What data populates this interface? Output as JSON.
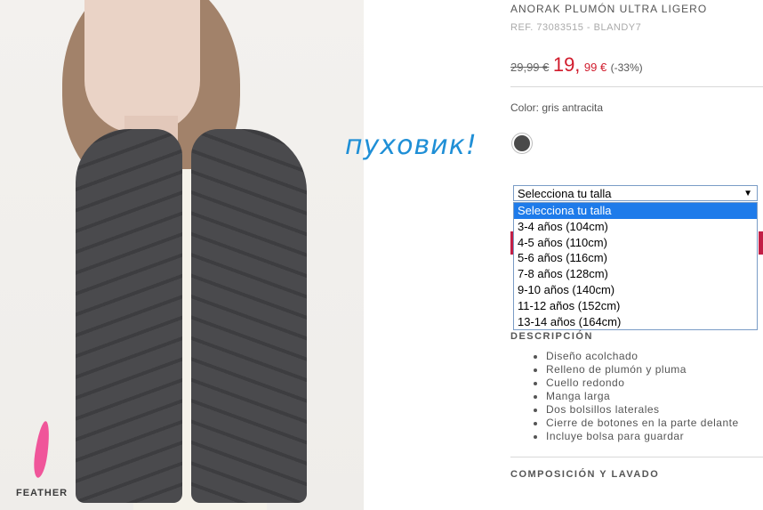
{
  "annotation": "пуховик!",
  "photo": {
    "badge_label": "FEATHER"
  },
  "product": {
    "title": "ANORAK PLUMÓN ULTRA LIGERO",
    "ref": "REF. 73083515 - BLANDY7",
    "old_price": "29,99 €",
    "new_price_int": "19,",
    "new_price_dec": "99 €",
    "discount": "(-33%)",
    "color_label": "Color: gris antracita",
    "swatch_color": "#4a4a4a"
  },
  "size_select": {
    "value": "Selecciona tu talla",
    "options": [
      "Selecciona tu talla",
      "3-4 años (104cm)",
      "4-5 años (110cm)",
      "5-6 años (116cm)",
      "7-8 años (128cm)",
      "9-10 años (140cm)",
      "11-12 años (152cm)",
      "13-14 años (164cm)"
    ]
  },
  "description": {
    "title": "DESCRIPCIÓN",
    "items": [
      "Diseño acolchado",
      "Relleno de plumón y pluma",
      "Cuello redondo",
      "Manga larga",
      "Dos bolsillos laterales",
      "Cierre de botones en la parte delante",
      "Incluye bolsa para guardar"
    ]
  },
  "composition": {
    "title": "COMPOSICIÓN Y LAVADO"
  }
}
